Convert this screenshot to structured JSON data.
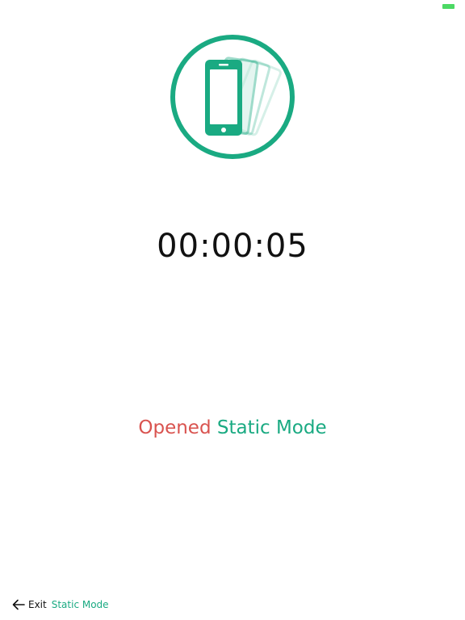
{
  "status_bar": {
    "battery_color": "#4cd964"
  },
  "icon": {
    "name": "phone-shake-icon",
    "accent_color": "#1aaa82"
  },
  "timer": {
    "value": "00:00:05"
  },
  "status": {
    "opened_label": "Opened",
    "mode_label": "Static Mode",
    "opened_color": "#d9534f",
    "mode_color": "#1aaa82"
  },
  "footer": {
    "back_icon": "arrow-left-icon",
    "exit_label": "Exit",
    "mode_label": "Static Mode"
  }
}
